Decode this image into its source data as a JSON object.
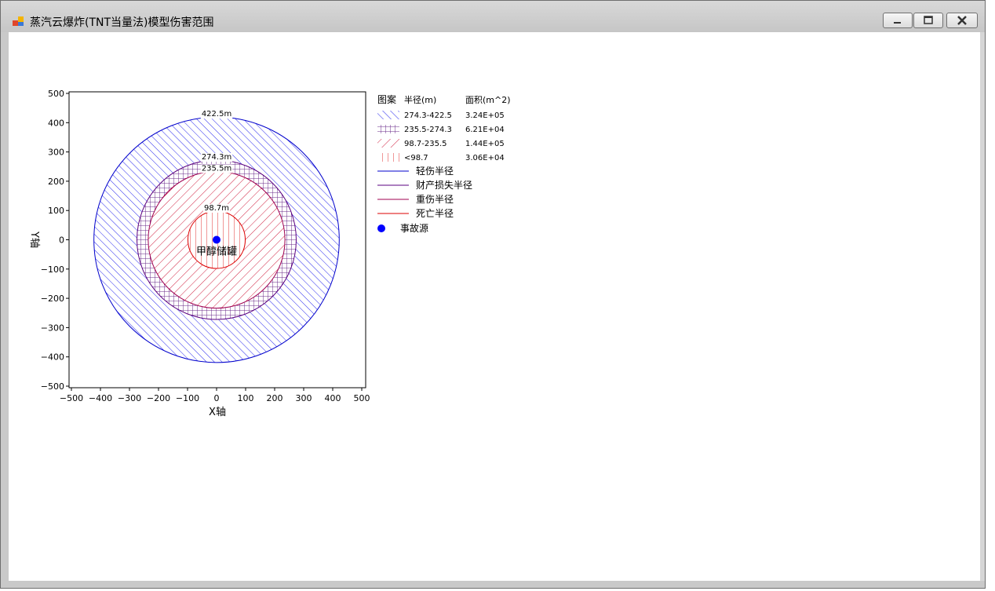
{
  "window": {
    "title": "蒸汽云爆炸(TNT当量法)模型伤害范围",
    "icon": "app-window-icon",
    "controls": [
      "minimize-icon",
      "maximize-icon",
      "close-icon"
    ]
  },
  "chart_data": {
    "type": "scatter",
    "xlabel": "X轴",
    "ylabel": "Y轴",
    "xlim": [
      -500,
      500
    ],
    "ylim": [
      -500,
      500
    ],
    "x_ticks": [
      -500,
      -400,
      -300,
      -200,
      -100,
      0,
      100,
      200,
      300,
      400,
      500
    ],
    "y_ticks": [
      500,
      400,
      300,
      200,
      100,
      0,
      -100,
      -200,
      -300,
      -400,
      -500
    ],
    "grid": false,
    "legend_position": "right",
    "source": {
      "label": "甲醇储罐",
      "x": 0,
      "y": 0,
      "color": "#0000ff"
    },
    "circles": [
      {
        "name": "轻伤半径",
        "radius": 422.5,
        "label": "422.5m",
        "color": "#0000cc"
      },
      {
        "name": "财产损失半径",
        "radius": 274.3,
        "label": "274.3m",
        "color": "#5a0080"
      },
      {
        "name": "重伤半径",
        "radius": 235.5,
        "label": "235.5m",
        "color": "#a00050"
      },
      {
        "name": "死亡半径",
        "radius": 98.7,
        "label": "98.7m",
        "color": "#dd0000"
      }
    ],
    "bands": [
      {
        "pattern": "diag-blue",
        "radius_range": "274.3-422.5",
        "area": "3.24E+05"
      },
      {
        "pattern": "grid-purple",
        "radius_range": "235.5-274.3",
        "area": "6.21E+04"
      },
      {
        "pattern": "diag-red",
        "radius_range": "98.7-235.5",
        "area": "1.44E+05"
      },
      {
        "pattern": "vert-red",
        "radius_range": "<98.7",
        "area": "3.06E+04"
      }
    ],
    "legend": {
      "headers": [
        "图案",
        "半径(m)",
        "面积(m^2)"
      ],
      "source_label": "事故源"
    }
  }
}
